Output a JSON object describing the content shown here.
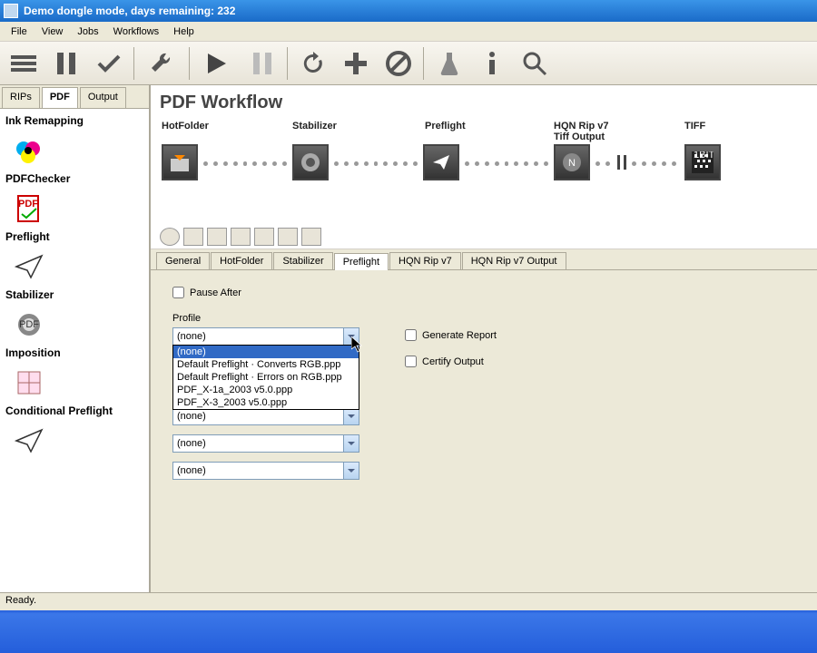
{
  "title": "Demo dongle mode, days remaining: 232",
  "menu": {
    "file": "File",
    "view": "View",
    "jobs": "Jobs",
    "workflows": "Workflows",
    "help": "Help"
  },
  "side_tabs": {
    "rips": "RIPs",
    "pdf": "PDF",
    "output": "Output",
    "active": "pdf"
  },
  "sidebar": {
    "items": [
      {
        "label": "Ink Remapping"
      },
      {
        "label": "PDFChecker"
      },
      {
        "label": "Preflight"
      },
      {
        "label": "Stabilizer"
      },
      {
        "label": "Imposition"
      },
      {
        "label": "Conditional Preflight"
      }
    ]
  },
  "main": {
    "title": "PDF Workflow"
  },
  "flow": {
    "nodes": [
      {
        "label": "HotFolder"
      },
      {
        "label": "Stabilizer"
      },
      {
        "label": "Preflight"
      },
      {
        "label": "HQN Rip v7 Tiff Output"
      },
      {
        "label": "TIFF"
      }
    ]
  },
  "tabs": {
    "items": [
      "General",
      "HotFolder",
      "Stabilizer",
      "Preflight",
      "HQN Rip v7",
      "HQN Rip v7 Output"
    ],
    "active": 3
  },
  "preflight": {
    "pause_after": "Pause After",
    "profile_label": "Profile",
    "gen_report": "Generate Report",
    "certify": "Certify Output",
    "combo_value": "(none)",
    "dropdown": [
      "(none)",
      "Default Preflight · Converts RGB.ppp",
      "Default Preflight · Errors on RGB.ppp",
      "PDF_X-1a_2003 v5.0.ppp",
      "PDF_X-3_2003 v5.0.ppp"
    ],
    "none": "(none)"
  },
  "status": "Ready."
}
